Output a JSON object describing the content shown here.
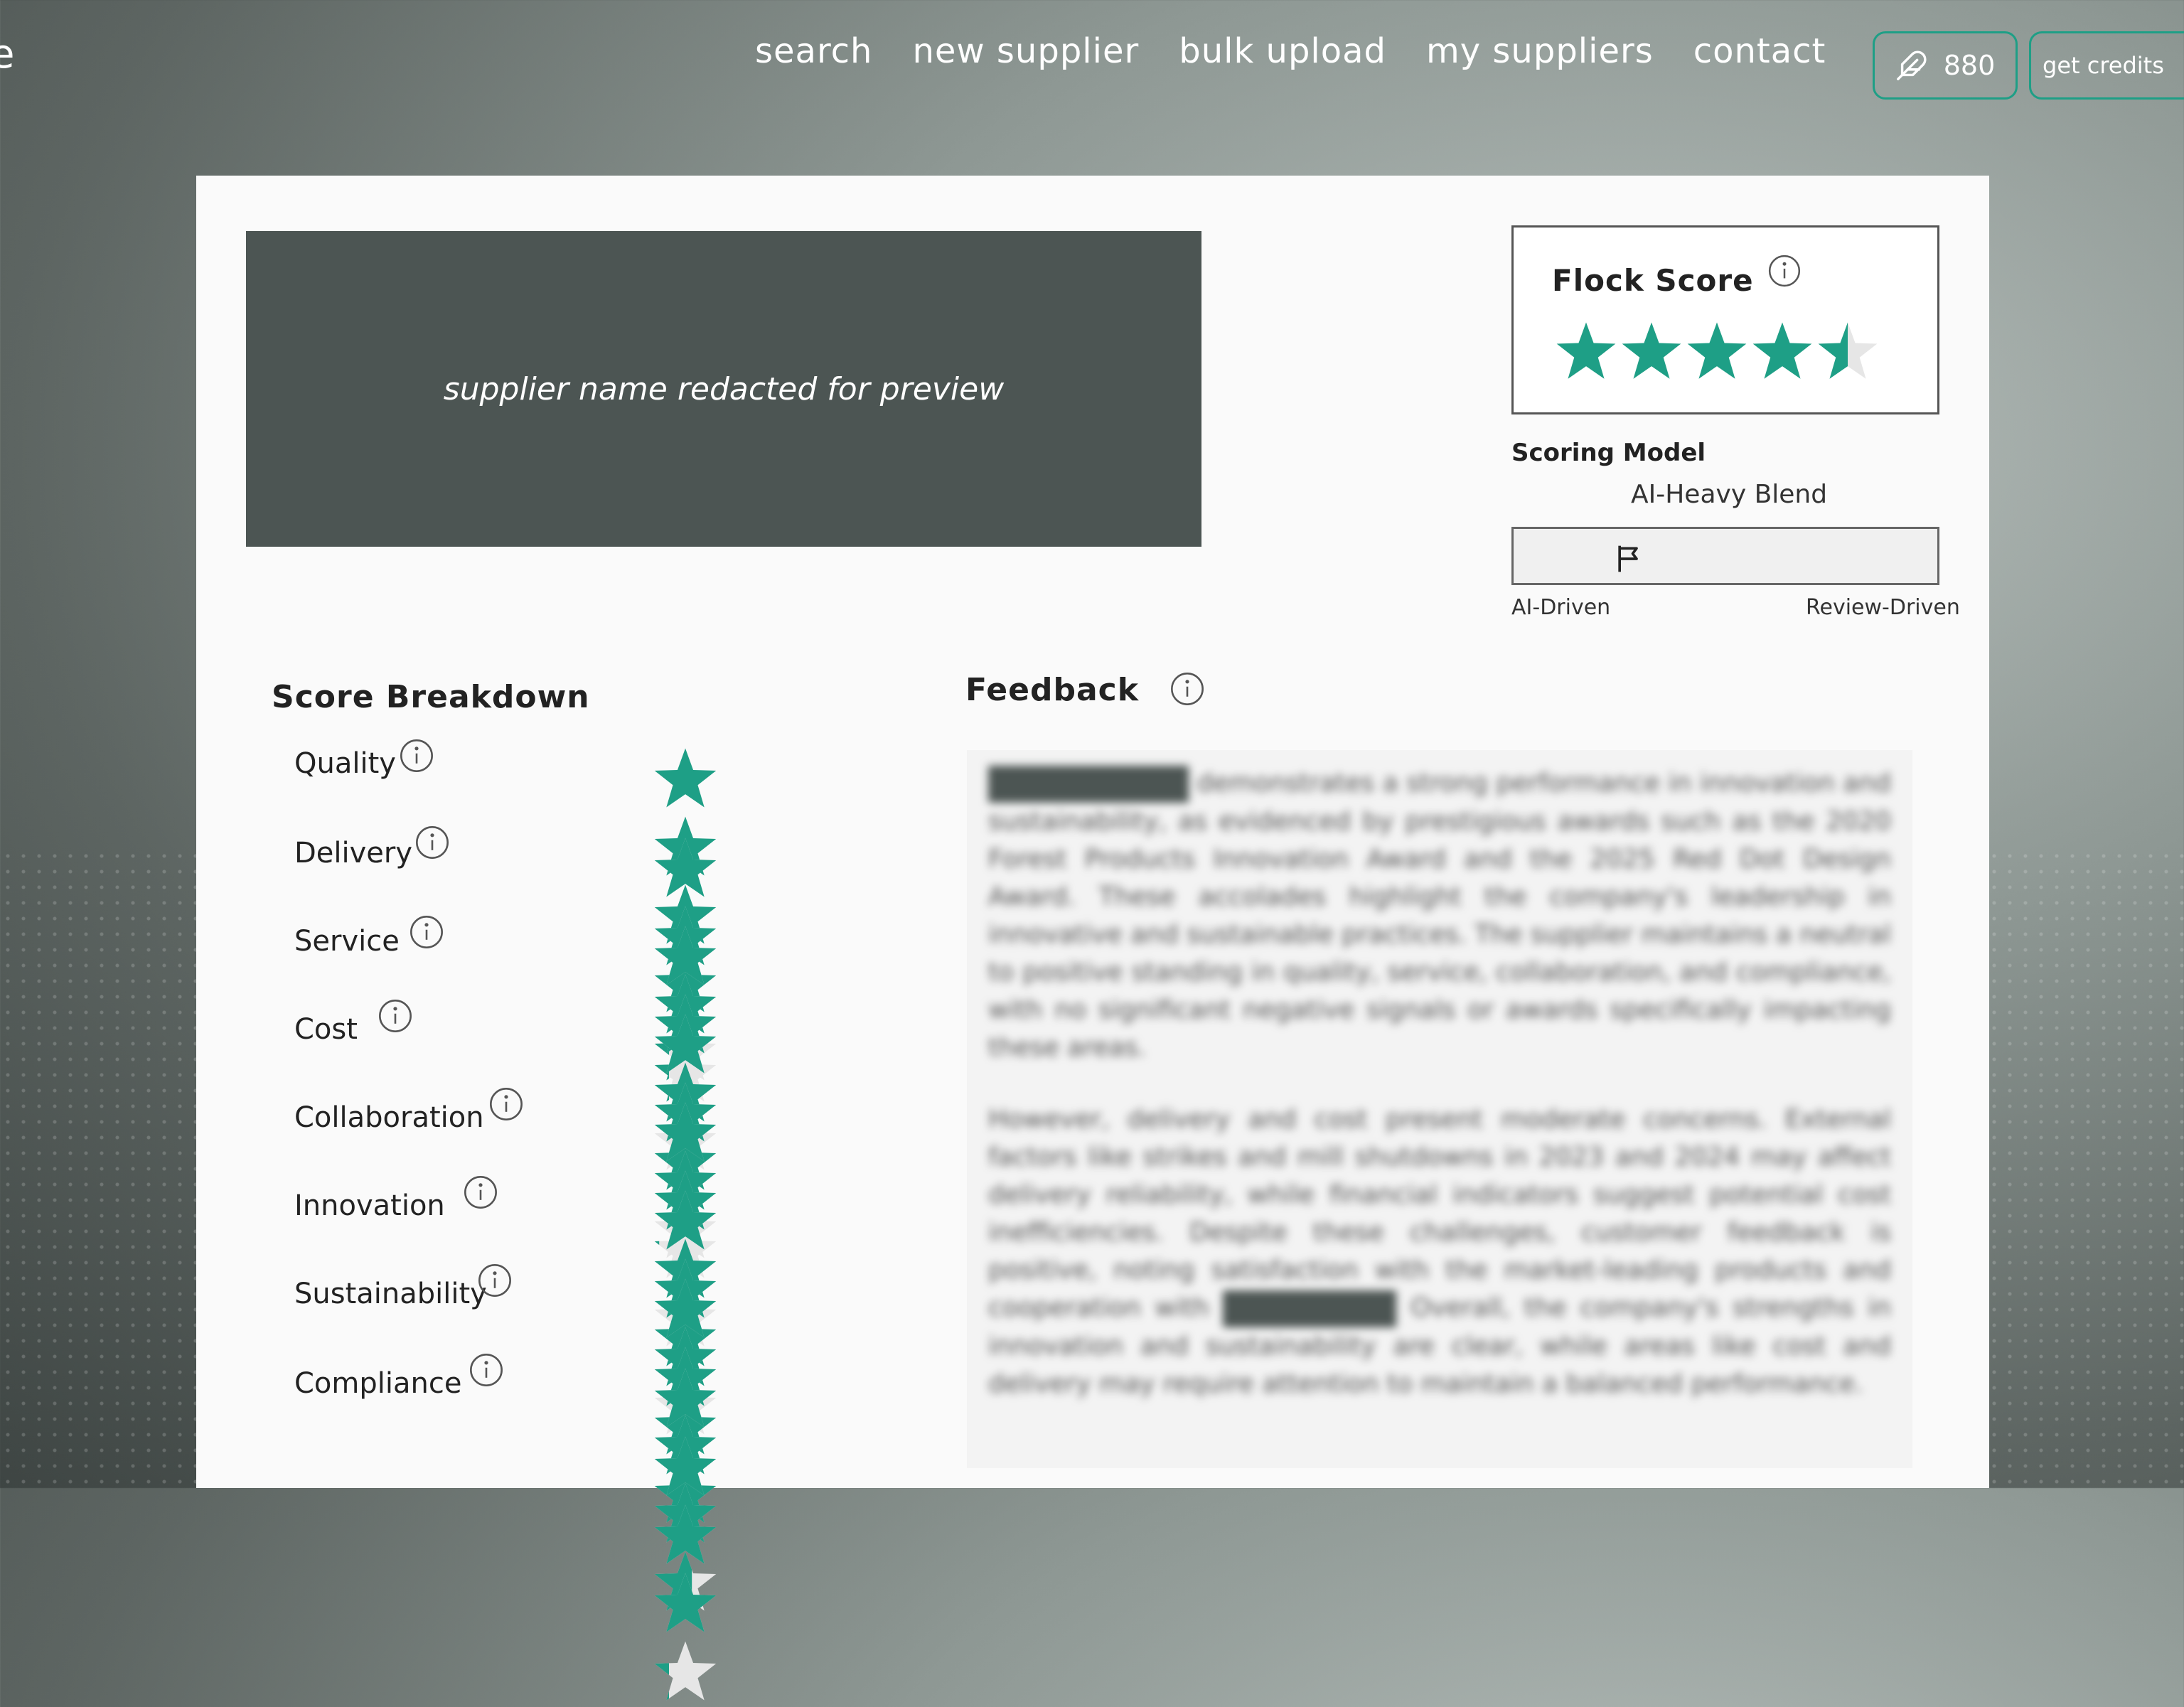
{
  "nav": {
    "logo_fragment": "e",
    "links": [
      "search",
      "new supplier",
      "bulk upload",
      "my suppliers",
      "contact"
    ],
    "credits": "880",
    "get_credits_label": "get credits"
  },
  "colors": {
    "accent": "#1e9f86",
    "star_empty": "#e6e6e6",
    "banner": "#4c5553"
  },
  "banner": {
    "text": "supplier name redacted for preview"
  },
  "flock_score": {
    "title": "Flock Score",
    "rating": 4.5,
    "max": 5
  },
  "scoring_model": {
    "label": "Scoring Model",
    "value": "AI-Heavy Blend",
    "slider_left": "AI-Driven",
    "slider_right": "Review-Driven",
    "position": 0.25
  },
  "breakdown": {
    "title": "Score Breakdown",
    "items": [
      {
        "label": "Quality",
        "rating": 4.25
      },
      {
        "label": "Delivery",
        "rating": 3.25
      },
      {
        "label": "Service",
        "rating": 4.0
      },
      {
        "label": "Cost",
        "rating": 3.1
      },
      {
        "label": "Collaboration",
        "rating": 4.0
      },
      {
        "label": "Innovation",
        "rating": 5.0
      },
      {
        "label": "Sustainability",
        "rating": 4.6
      },
      {
        "label": "Compliance",
        "rating": 4.25
      }
    ]
  },
  "feedback": {
    "title": "Feedback",
    "p1": "demonstrates a strong performance in innovation and sustainability, as evidenced by prestigious awards such as the 2020 Forest Products Innovation Award and the 2025 Red Dot Design Award. These accolades highlight the company's leadership in innovative and sustainable practices. The supplier maintains a neutral to positive standing in quality, service, collaboration, and compliance, with no significant negative signals or awards specifically impacting these areas.",
    "p2a": "However, delivery and cost present moderate concerns. External factors like strikes and mill shutdowns in 2023 and 2024 may affect delivery reliability, while financial indicators suggest potential cost inefficiencies. Despite these challenges, customer feedback is positive, noting satisfaction with the market-leading products and cooperation with",
    "p2b": "Overall, the company's strengths in innovation and sustainability are clear, while areas like cost and delivery may require attention to maintain a balanced performance."
  }
}
